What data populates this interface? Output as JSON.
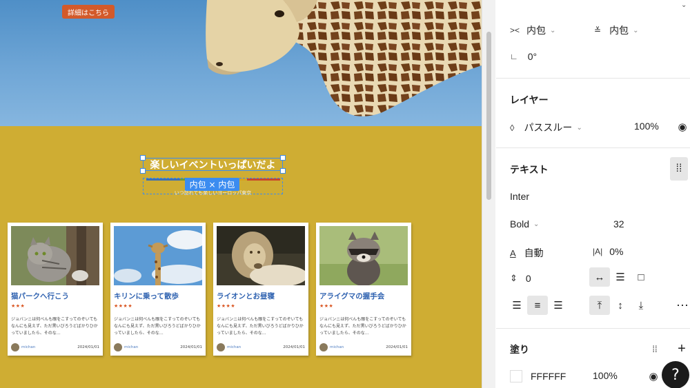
{
  "canvas": {
    "detail_button": "詳細はこちら",
    "heading": "楽しいイベントいっぱいだよ",
    "subheading": "いつ訪れても楽しいヨーロッパ東京",
    "hug_badge": "内包 × 内包",
    "accent_colors": [
      "#3b6fb6",
      "#6a9a3a",
      "#d6a21f",
      "#c9452b"
    ],
    "cards": [
      {
        "title": "猫パークへ行こう",
        "stars": "★★★",
        "desc": "ジョバンニは何べんも眼をこすってのぞいてもなんにも見えず、ただ黒いびろうどばかりひかっていましたら、そのな…",
        "author": "michan",
        "date": "2024/01/01"
      },
      {
        "title": "キリンに乗って散歩",
        "stars": "★★★★",
        "desc": "ジョバンニは何べんも眼をこすってのぞいてもなんにも見えず、ただ黒いびろうどばかりひかっていましたら、そのな…",
        "author": "michan",
        "date": "2024/01/01"
      },
      {
        "title": "ライオンとお昼寝",
        "stars": "★★★★",
        "desc": "ジョバンニは何べんも眼をこすってのぞいてもなんにも見えず、ただ黒いびろうどばかりひかっていましたら、そのな…",
        "author": "michan",
        "date": "2024/01/01"
      },
      {
        "title": "アライグマの握手会",
        "stars": "★★★",
        "desc": "ジョバンニは何べんも眼をこすってのぞいてもなんにも見えず、ただ黒いびろうどばかりひかっていましたら、そのな…",
        "author": "michan",
        "date": "2024/01/01"
      }
    ]
  },
  "panel": {
    "sizing": {
      "width_mode": "内包",
      "height_mode": "内包",
      "rotation": "0°"
    },
    "layer": {
      "title": "レイヤー",
      "blend": "パススルー",
      "opacity": "100%"
    },
    "text": {
      "title": "テキスト",
      "font": "Inter",
      "weight": "Bold",
      "size": "32",
      "line_height": "自動",
      "letter_spacing": "0%",
      "paragraph_spacing": "0"
    },
    "fill": {
      "title": "塗り",
      "hex": "FFFFFF",
      "opacity": "100%"
    },
    "help": "?"
  },
  "colors": {
    "canvas_bg": "#cfad33",
    "selection": "#3b8cf0",
    "button": "#d35a2a",
    "card_title": "#2f62b0"
  }
}
